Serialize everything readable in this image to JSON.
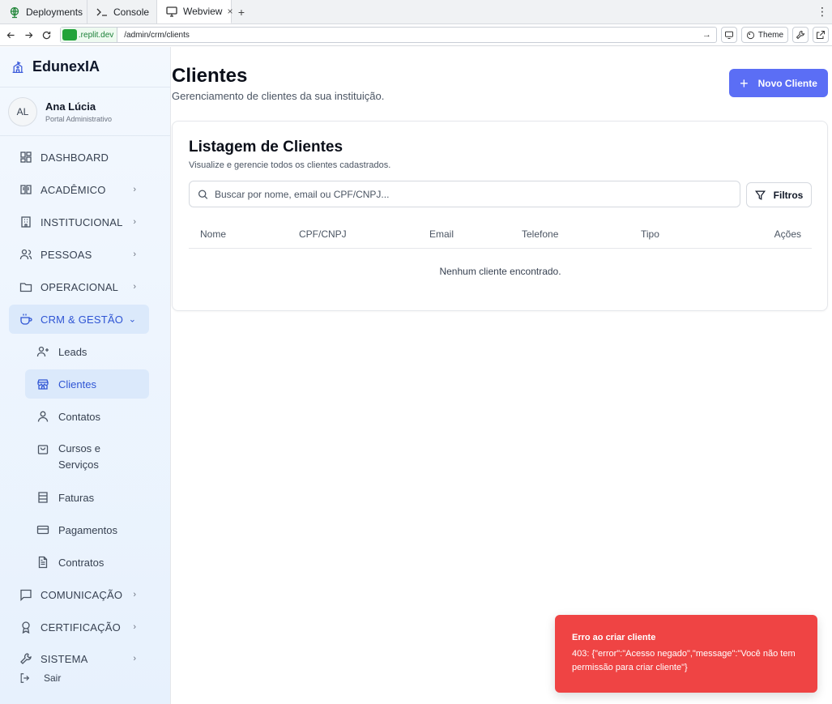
{
  "browser": {
    "tabs": [
      {
        "label": "Deployments",
        "icon": "globe-icon"
      },
      {
        "label": "Console",
        "icon": "terminal-icon"
      },
      {
        "label": "Webview",
        "icon": "monitor-icon",
        "close": "×"
      }
    ],
    "new_tab": "+",
    "menu": "⋮",
    "host": ".replit.dev",
    "path": "/admin/crm/clients",
    "go": "→",
    "theme_label": "Theme"
  },
  "sidebar": {
    "brand": "EdunexIA",
    "user": {
      "initials": "AL",
      "name": "Ana Lúcia",
      "role": "Portal Administrativo"
    },
    "nav": [
      {
        "label": "DASHBOARD",
        "icon": "dashboard-icon"
      },
      {
        "label": "ACADÊMICO",
        "icon": "book-icon",
        "chevron": "›"
      },
      {
        "label": "INSTITUCIONAL",
        "icon": "building-icon",
        "chevron": "›"
      },
      {
        "label": "PESSOAS",
        "icon": "users-icon",
        "chevron": "›"
      },
      {
        "label": "OPERACIONAL",
        "icon": "folder-icon",
        "chevron": "›"
      },
      {
        "label": "CRM & GESTÃO",
        "icon": "coffee-icon",
        "chevron": "⌄",
        "active": true
      },
      {
        "label": "COMUNICAÇÃO",
        "icon": "message-icon",
        "chevron": "›"
      },
      {
        "label": "CERTIFICAÇÃO",
        "icon": "award-icon",
        "chevron": "›"
      },
      {
        "label": "SISTEMA",
        "icon": "wrench-icon",
        "chevron": "›"
      }
    ],
    "sub": [
      {
        "label": "Leads",
        "icon": "user-plus-icon"
      },
      {
        "label": "Clientes",
        "icon": "store-icon",
        "active": true
      },
      {
        "label": "Contatos",
        "icon": "user-icon"
      },
      {
        "label": "Cursos e",
        "label2": "Serviços",
        "icon": "shopping-bag-icon"
      },
      {
        "label": "Faturas",
        "icon": "receipt-icon"
      },
      {
        "label": "Pagamentos",
        "icon": "credit-card-icon"
      },
      {
        "label": "Contratos",
        "icon": "file-text-icon"
      }
    ],
    "logout": "Sair"
  },
  "main": {
    "title": "Clientes",
    "subtitle": "Gerenciamento de clientes da sua instituição.",
    "new_button": "Novo Cliente",
    "card": {
      "title": "Listagem de Clientes",
      "subtitle": "Visualize e gerencie todos os clientes cadastrados.",
      "search_placeholder": "Buscar por nome, email ou CPF/CNPJ...",
      "filter_label": "Filtros",
      "columns": [
        "Nome",
        "CPF/CNPJ",
        "Email",
        "Telefone",
        "Tipo",
        "Ações"
      ],
      "empty": "Nenhum cliente encontrado."
    }
  },
  "toast": {
    "title": "Erro ao criar cliente",
    "message": "403: {\"error\":\"Acesso negado\",\"message\":\"Você não tem permissão para criar cliente\"}"
  },
  "colors": {
    "accent": "#5b6ef5",
    "active_text": "#2f55d4",
    "active_bg": "#dbe9fb",
    "toast_bg": "#ef4444"
  }
}
